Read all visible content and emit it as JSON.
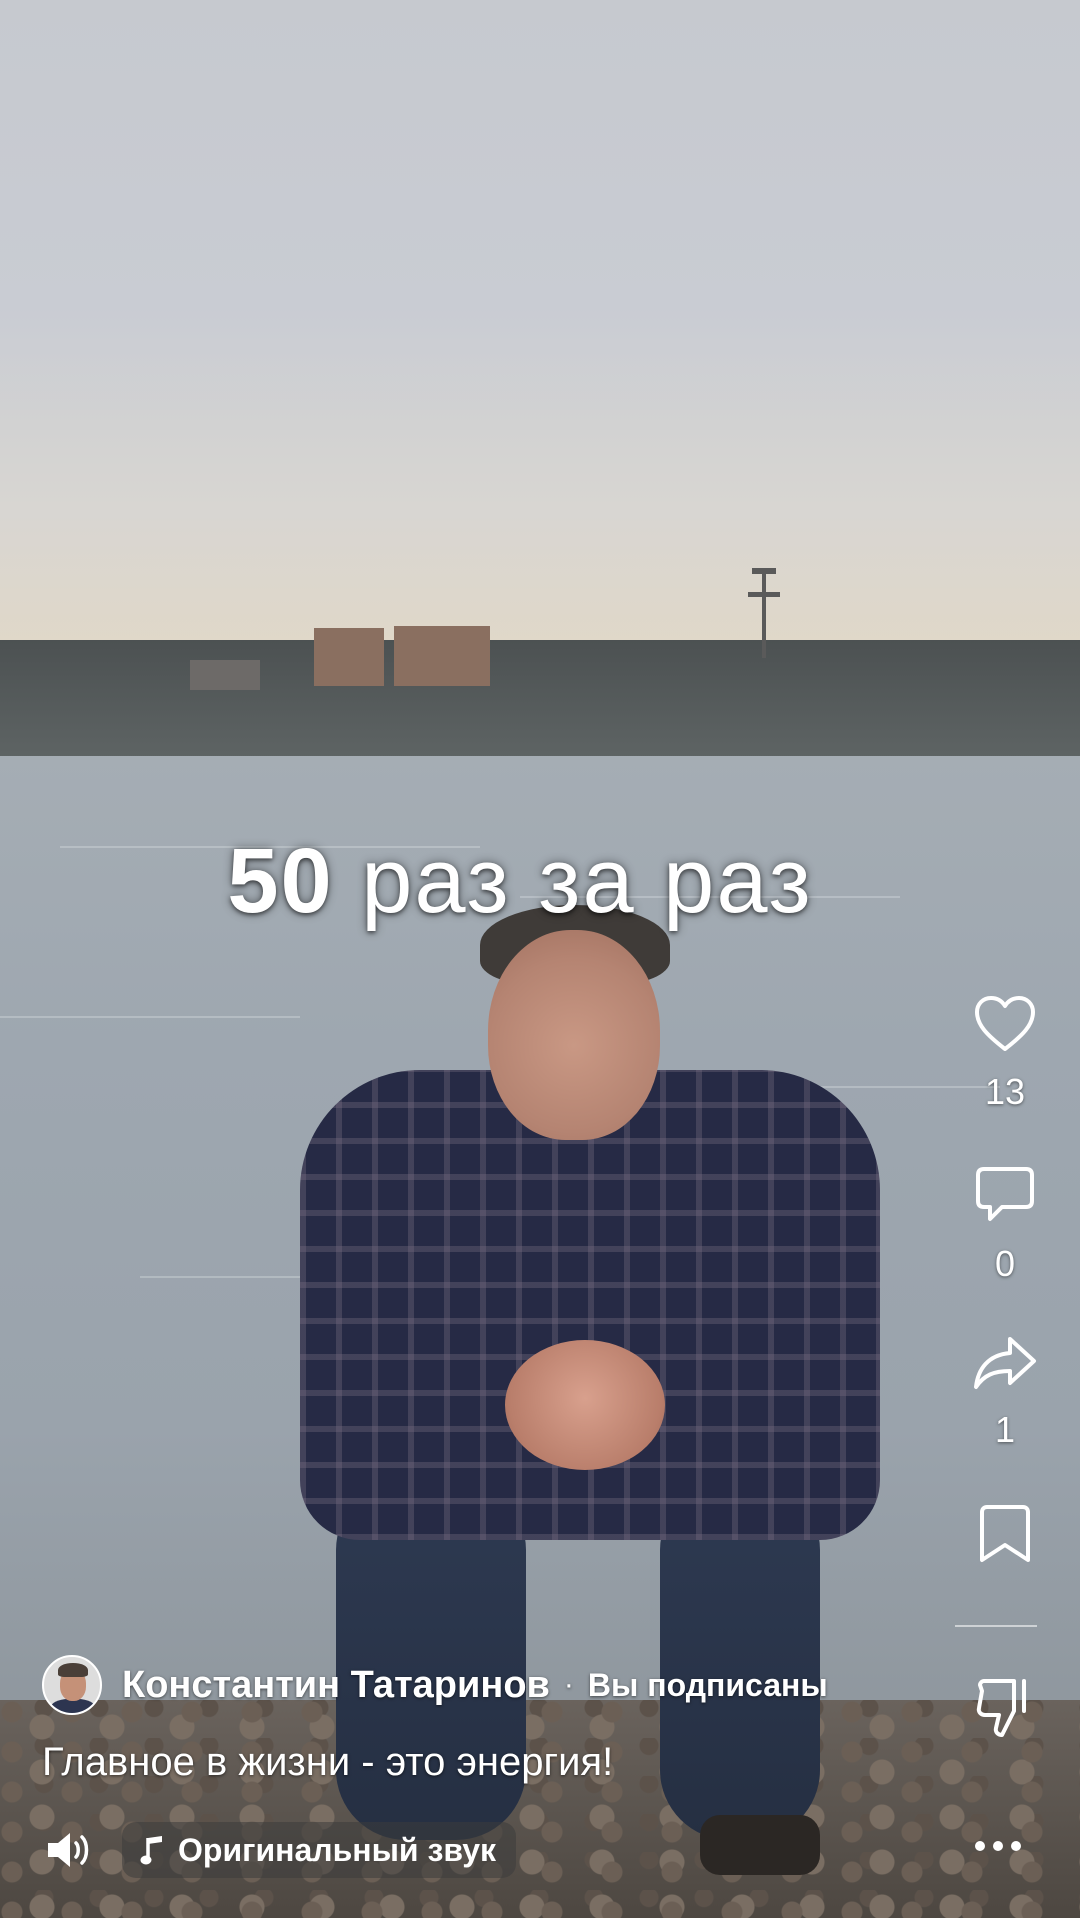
{
  "video": {
    "caption_number": "50",
    "caption_rest": " раз за раз"
  },
  "actions": {
    "likes": "13",
    "comments": "0",
    "shares": "1"
  },
  "author": {
    "name": "Константин Татаринов",
    "separator": "·",
    "subscription": "Вы подписаны"
  },
  "description": "Главное в жизни - это энергия!",
  "audio": {
    "label": "Оригинальный звук"
  },
  "icons": [
    "heart-icon",
    "comment-icon",
    "share-icon",
    "bookmark-icon",
    "dislike-icon",
    "speaker-icon",
    "music-note-icon",
    "more-icon"
  ]
}
